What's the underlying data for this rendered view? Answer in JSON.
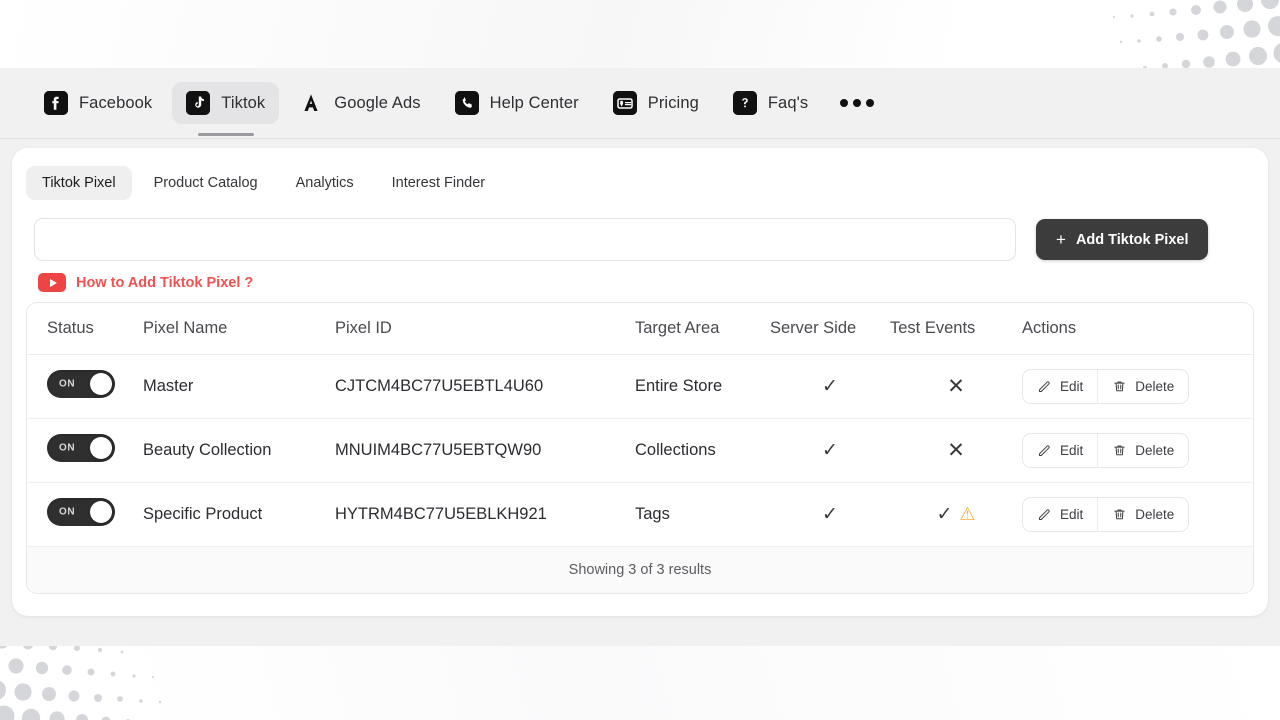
{
  "topnav": {
    "items": [
      {
        "label": "Facebook",
        "icon": "facebook-icon",
        "active": false
      },
      {
        "label": "Tiktok",
        "icon": "tiktok-icon",
        "active": true
      },
      {
        "label": "Google Ads",
        "icon": "google-ads-icon",
        "active": false
      },
      {
        "label": "Help Center",
        "icon": "phone-icon",
        "active": false
      },
      {
        "label": "Pricing",
        "icon": "pricing-card-icon",
        "active": false
      },
      {
        "label": "Faq's",
        "icon": "question-icon",
        "active": false
      }
    ],
    "more_icon": "more-horizontal-icon"
  },
  "subtabs": [
    {
      "label": "Tiktok Pixel",
      "active": true
    },
    {
      "label": "Product Catalog",
      "active": false
    },
    {
      "label": "Analytics",
      "active": false
    },
    {
      "label": "Interest Finder",
      "active": false
    }
  ],
  "search": {
    "value": "",
    "placeholder": ""
  },
  "add_button": {
    "label": "Add Tiktok Pixel",
    "plus": "+"
  },
  "help_link": {
    "text": "How to Add Tiktok Pixel ?",
    "icon": "youtube-play-icon",
    "color": "#f05252"
  },
  "table": {
    "headers": [
      "Status",
      "Pixel Name",
      "Pixel ID",
      "Target Area",
      "Server Side",
      "Test Events",
      "Actions"
    ],
    "rows": [
      {
        "status": "ON",
        "name": "Master",
        "pixel_id": "CJTCM4BC77U5EBTL4U60",
        "target_area": "Entire Store",
        "server_side": "check",
        "test_events": "cross",
        "test_warning": false,
        "edit_label": "Edit",
        "delete_label": "Delete"
      },
      {
        "status": "ON",
        "name": "Beauty Collection",
        "pixel_id": "MNUIM4BC77U5EBTQW90",
        "target_area": "Collections",
        "server_side": "check",
        "test_events": "cross",
        "test_warning": false,
        "edit_label": "Edit",
        "delete_label": "Delete"
      },
      {
        "status": "ON",
        "name": "Specific Product",
        "pixel_id": "HYTRM4BC77U5EBLKH921",
        "target_area": "Tags",
        "server_side": "check",
        "test_events": "check",
        "test_warning": true,
        "edit_label": "Edit",
        "delete_label": "Delete"
      }
    ],
    "footer": "Showing 3 of 3 results"
  },
  "glyphs": {
    "check": "✓",
    "cross": "✕",
    "warning": "⚠"
  },
  "colors": {
    "accent_dark": "#3c3c3c",
    "help_red": "#f05252",
    "warning_yellow": "#f5b52a",
    "band": "#f1f1f2"
  }
}
